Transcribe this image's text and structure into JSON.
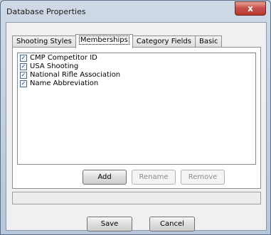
{
  "window": {
    "title": "Database Properties",
    "close_label": "x"
  },
  "tabs": [
    {
      "label": "Shooting Styles"
    },
    {
      "label": "Memberships",
      "active": true
    },
    {
      "label": "Category Fields"
    },
    {
      "label": "Basic"
    }
  ],
  "memberships": {
    "items": [
      {
        "label": "CMP Competitor ID",
        "checked": true
      },
      {
        "label": "USA Shooting",
        "checked": true
      },
      {
        "label": "National Rifle Association",
        "checked": true
      },
      {
        "label": "Name Abbreviation",
        "checked": true
      }
    ],
    "add_label": "Add",
    "rename_label": "Rename",
    "remove_label": "Remove"
  },
  "footer": {
    "save_label": "Save",
    "cancel_label": "Cancel"
  }
}
